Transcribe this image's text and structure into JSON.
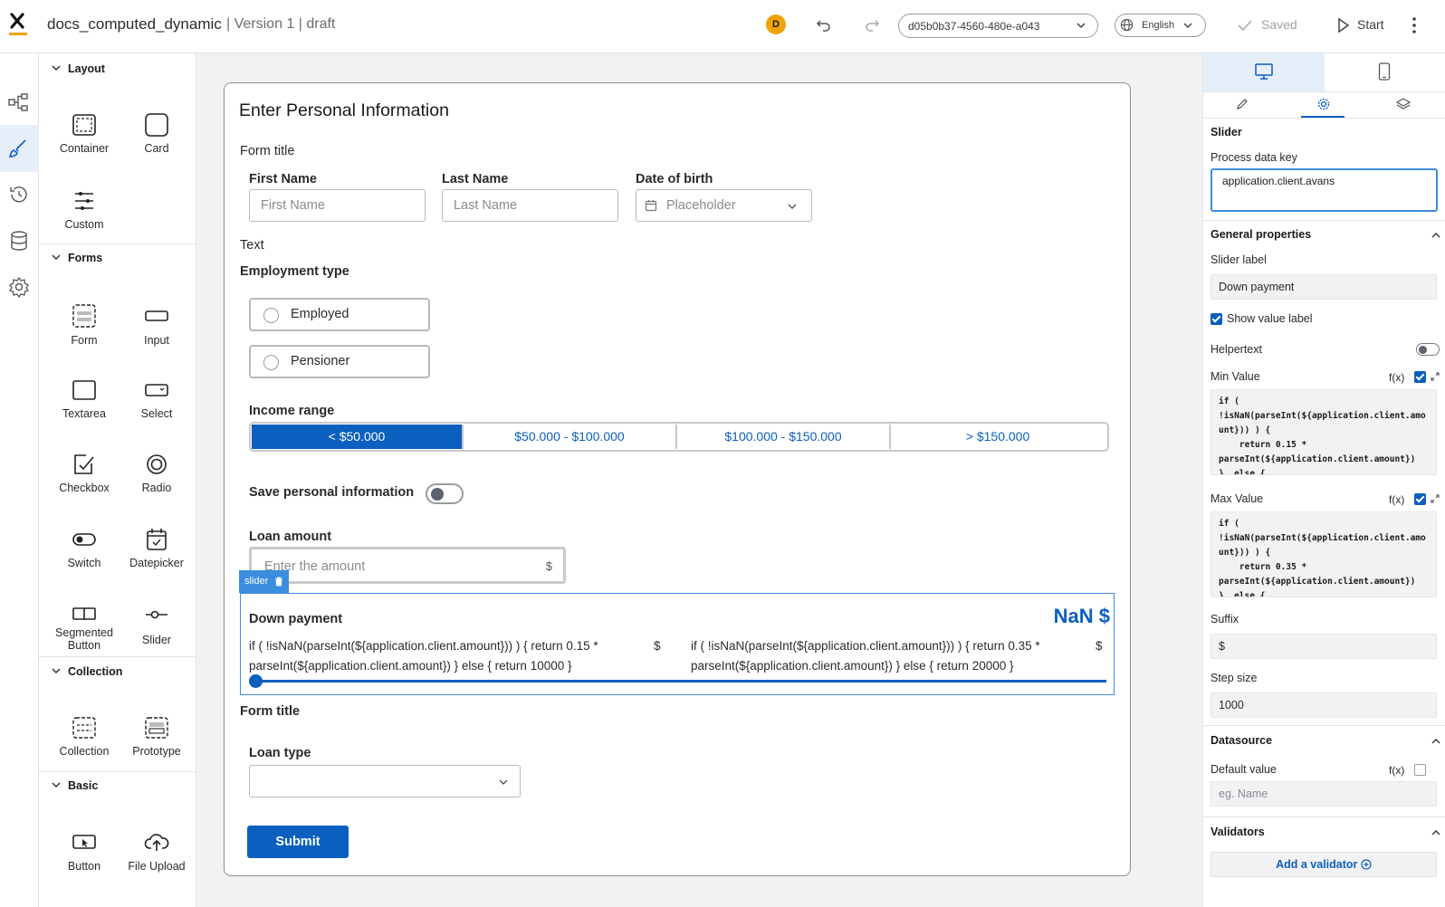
{
  "topbar": {
    "doc_name": "docs_computed_dynamic",
    "version": "| Version 1 | draft",
    "avatar_initial": "D",
    "id_select": "d05b0b37-4560-480e-a043",
    "language": "English",
    "saved_label": "Saved",
    "start_label": "Start"
  },
  "palette": {
    "sections": {
      "layout": "Layout",
      "forms": "Forms",
      "collection": "Collection",
      "basic": "Basic"
    },
    "items": {
      "container": "Container",
      "card": "Card",
      "custom": "Custom",
      "form": "Form",
      "input": "Input",
      "textarea": "Textarea",
      "select": "Select",
      "checkbox": "Checkbox",
      "radio": "Radio",
      "switch": "Switch",
      "datepicker": "Datepicker",
      "segmented_button": "Segmented Button",
      "slider": "Slider",
      "collection": "Collection",
      "prototype": "Prototype",
      "button": "Button",
      "file_upload": "File Upload"
    }
  },
  "canvas": {
    "title": "Enter Personal Information",
    "form_title_1": "Form title",
    "first_name": {
      "label": "First Name",
      "placeholder": "First Name"
    },
    "last_name": {
      "label": "Last Name",
      "placeholder": "Last Name"
    },
    "dob": {
      "label": "Date of birth",
      "placeholder": "Placeholder"
    },
    "text": "Text",
    "employment_type": "Employment type",
    "radio_options": [
      "Employed",
      "Pensioner"
    ],
    "income_range": {
      "label": "Income range",
      "options": [
        "< $50.000",
        "$50.000 - $100.000",
        "$100.000 - $150.000",
        "> $150.000"
      ],
      "selected": "< $50.000"
    },
    "save_personal_info": "Save personal information",
    "loan_amount": {
      "label": "Loan amount",
      "placeholder": "Enter the amount",
      "suffix": "$"
    },
    "slider": {
      "tag": "slider",
      "label": "Down payment",
      "value": "NaN $",
      "min_text": "if ( !isNaN(parseInt(${application.client.amount})) ) { return 0.15 * parseInt(${application.client.amount}) } else { return 10000 }",
      "max_text": "if ( !isNaN(parseInt(${application.client.amount})) ) { return 0.35 * parseInt(${application.client.amount}) } else { return 20000 }",
      "suffix": "$",
      "position": 0
    },
    "form_title_2": "Form title",
    "loan_type": "Loan type",
    "submit": "Submit"
  },
  "panel": {
    "component": "Slider",
    "process_key_label": "Process data key",
    "process_key_value": "application.client.avans",
    "general_properties": "General properties",
    "slider_label_label": "Slider label",
    "slider_label_value": "Down payment",
    "show_value_label": "Show value label",
    "helpertext": "Helpertext",
    "min_value": "Min Value",
    "fx": "f(x)",
    "min_code": "if (\n!isNaN(parseInt(${application.client.amount})) ) {\n    return 0.15 *\nparseInt(${application.client.amount})\n}  else {",
    "max_value": "Max Value",
    "max_code": "if (\n!isNaN(parseInt(${application.client.amount})) ) {\n    return 0.35 *\nparseInt(${application.client.amount})\n}  else {",
    "suffix_label": "Suffix",
    "suffix_value": "$",
    "step_label": "Step size",
    "step_value": "1000",
    "datasource": "Datasource",
    "default_value": "Default value",
    "default_placeholder": "eg. Name",
    "validators": "Validators",
    "add_validator": "Add a validator"
  },
  "colors": {
    "accent": "#0a5fbf",
    "selection": "#3b8de0",
    "avatar": "#f0a30a"
  }
}
